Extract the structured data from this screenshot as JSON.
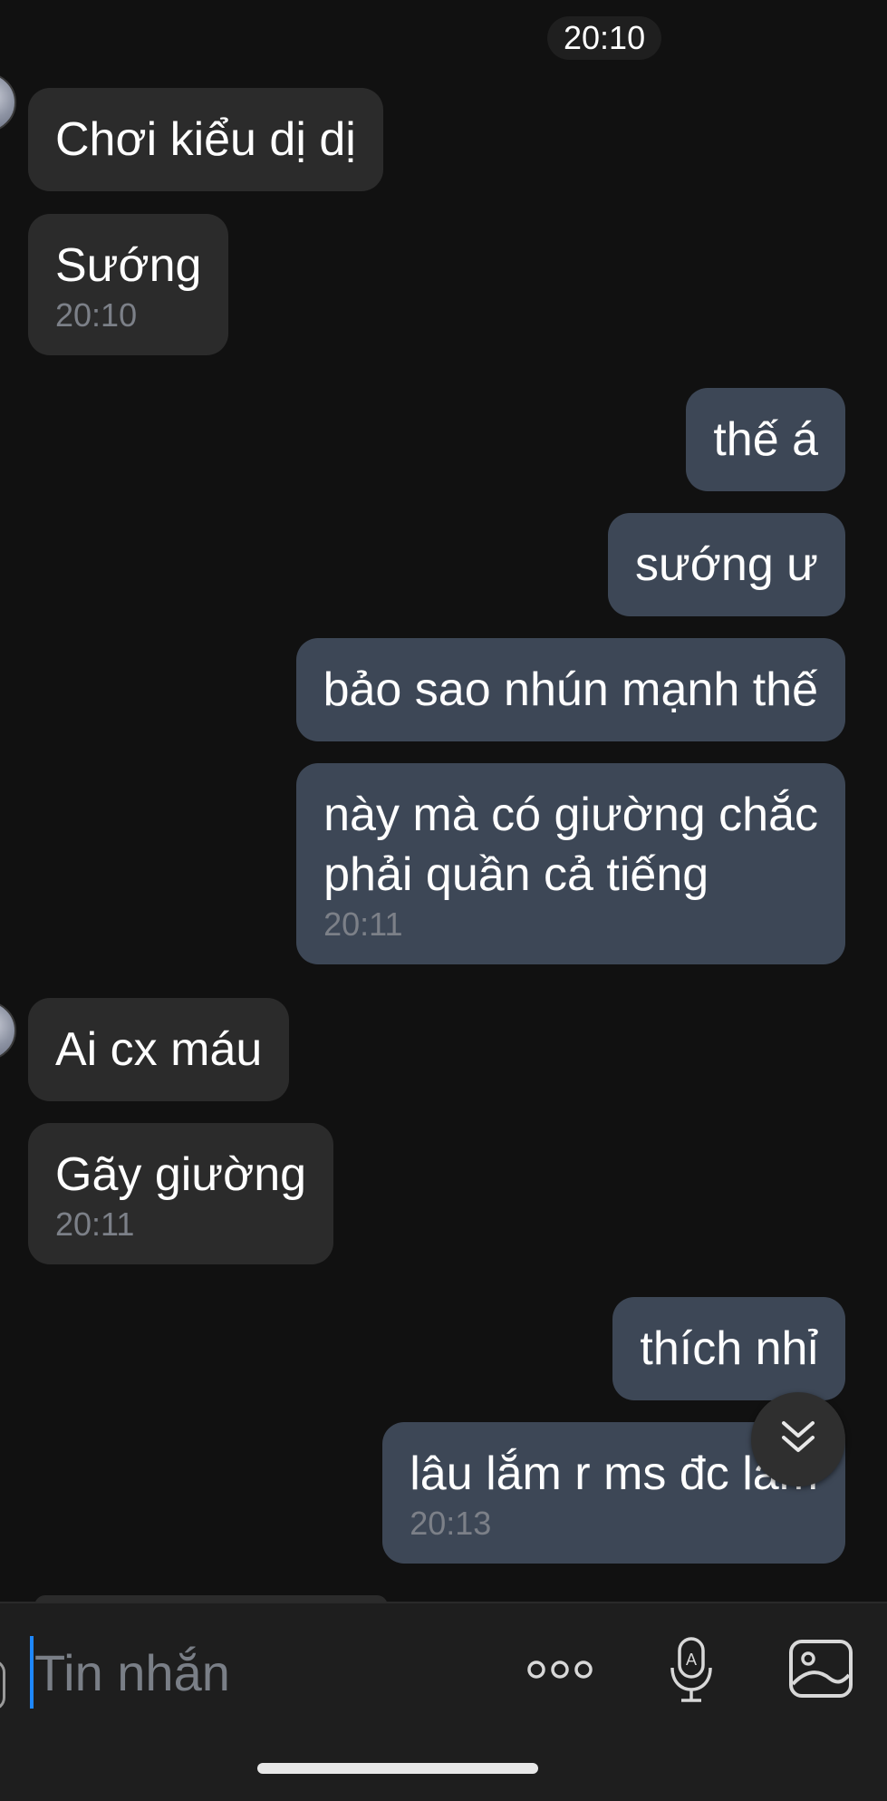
{
  "thread": {
    "time_separator": "20:10"
  },
  "messages": [
    {
      "side": "in",
      "text": "Chơi kiểu dị dị",
      "time": ""
    },
    {
      "side": "in",
      "text": "Sướng",
      "time": "20:10"
    },
    {
      "side": "out",
      "text": "thế á",
      "time": ""
    },
    {
      "side": "out",
      "text": "sướng ư",
      "time": ""
    },
    {
      "side": "out",
      "text": "bảo sao nhún mạnh thế",
      "time": ""
    },
    {
      "side": "out",
      "text": "này mà có giường chắc\nphải quần cả tiếng",
      "time": "20:11"
    },
    {
      "side": "in",
      "text": "Ai cx máu",
      "time": ""
    },
    {
      "side": "in",
      "text": "Gãy giường",
      "time": "20:11"
    },
    {
      "side": "out",
      "text": "thích nhỉ",
      "time": ""
    },
    {
      "side": "out",
      "text": "lâu lắm r ms đc làm",
      "time": "20:13"
    }
  ],
  "composer": {
    "placeholder": "Tin nhắn",
    "more_icon": "more-dots-icon",
    "voice_icon": "voice-text-mic-icon",
    "gallery_icon": "gallery-image-icon"
  },
  "scroll_button": {
    "icon": "double-chevron-down-icon"
  },
  "colors": {
    "background": "#111111",
    "incoming_bubble": "#2b2b2b",
    "outgoing_bubble": "#3d4756",
    "timestamp": "#7c8088",
    "caret": "#1e88ff"
  }
}
